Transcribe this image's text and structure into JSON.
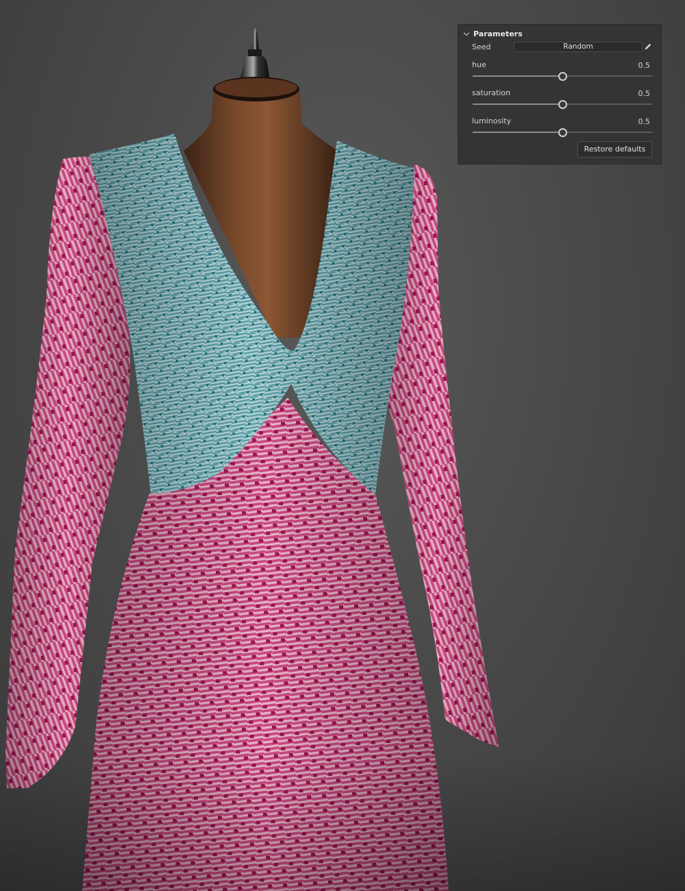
{
  "panel": {
    "title": "Parameters",
    "seed": {
      "label": "Seed",
      "button_label": "Random"
    },
    "params": [
      {
        "label": "hue",
        "value": "0.5",
        "level": 0.5
      },
      {
        "label": "saturation",
        "value": "0.5",
        "level": 0.5
      },
      {
        "label": "luminosity",
        "value": "0.5",
        "level": 0.5
      }
    ],
    "restore_label": "Restore defaults"
  },
  "colors": {
    "background": "#4a4a4a",
    "panel": "#343434",
    "fabric_pink": "#c8487e",
    "fabric_teal": "#63a4ad",
    "mannequin_wood": "#6b3e24"
  }
}
